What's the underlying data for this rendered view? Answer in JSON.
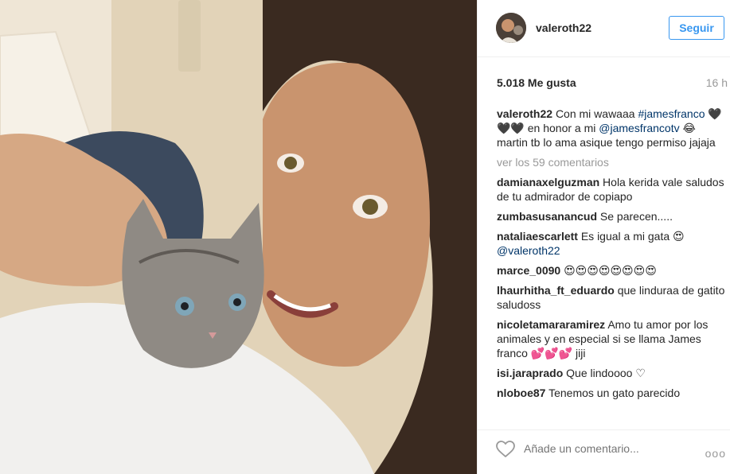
{
  "post": {
    "username": "valeroth22",
    "follow_label": "Seguir",
    "likes": "5.018 Me gusta",
    "time": "16 h",
    "caption": {
      "user": "valeroth22",
      "text1": "Con mi wawaaa",
      "hashtag": "#jamesfranco",
      "text2": "🖤🖤🖤 en honor a mi",
      "mention": "@jamesfrancotv",
      "text3": "😂 martin tb lo ama asique tengo permiso jajaja"
    },
    "view_more": "ver los 59 comentarios",
    "comments": [
      {
        "user": "damianaxelguzman",
        "text": "Hola kerida vale saludos de tu admirador de copiapo"
      },
      {
        "user": "zumbasusanancud",
        "text": "Se parecen....."
      },
      {
        "user": "nataliaescarlett",
        "text": "Es igual a mi gata 😍",
        "mention": "@valeroth22"
      },
      {
        "user": "marce_0090",
        "text": "😍😍😍😍😍😍😍😍"
      },
      {
        "user": "lhaurhitha_ft_eduardo",
        "text": "que linduraa de gatito saludoss"
      },
      {
        "user": "nicoletamararamirez",
        "text": "Amo tu amor por los animales y en especial si se llama James franco 💕💕💕 jiji"
      },
      {
        "user": "isi.jaraprado",
        "text": "Que lindoooo ♡"
      },
      {
        "user": "nloboe87",
        "text": "Tenemos un gato parecido"
      }
    ],
    "add_comment_placeholder": "Añade un comentario...",
    "more_label": "ooo"
  },
  "icons": {
    "like": "heart-outline-icon",
    "more": "more-options-icon"
  },
  "colors": {
    "link": "#003569",
    "follow": "#3897f0",
    "muted": "#999999"
  }
}
